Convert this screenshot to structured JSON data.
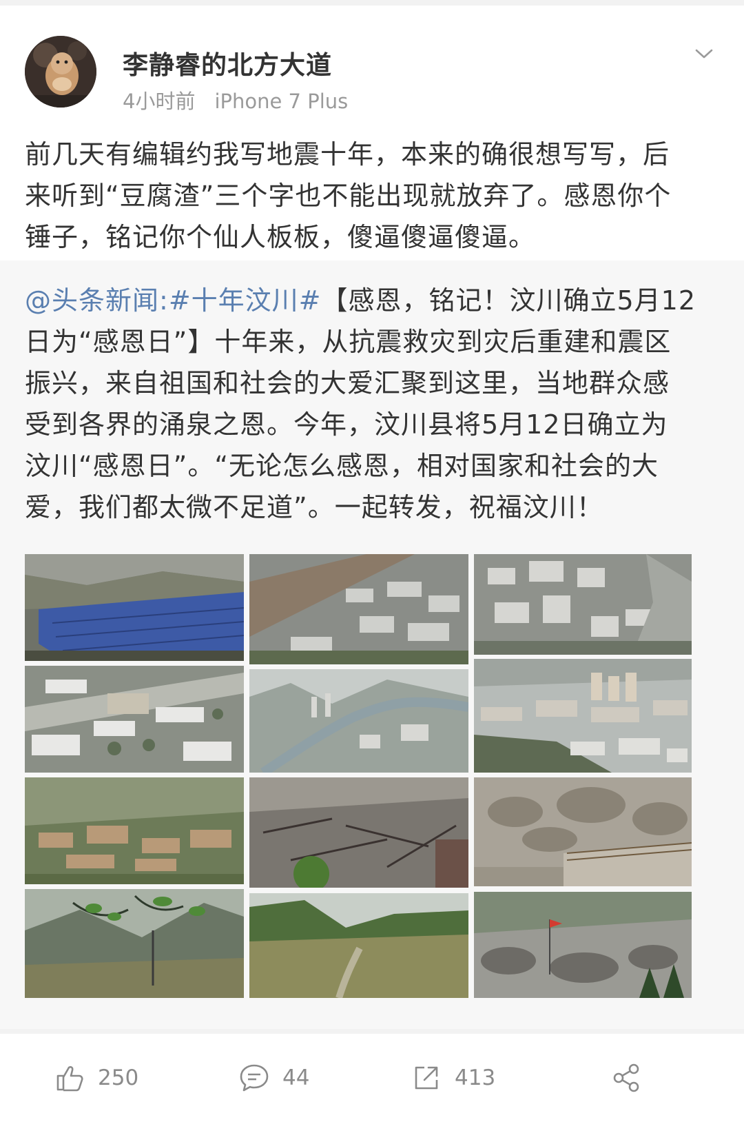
{
  "post": {
    "author": "李静睿的北方大道",
    "time": "4小时前",
    "source": "iPhone 7 Plus",
    "text_lines": [
      "前几天有编辑约我写地震十年，本来的确很想写写，后",
      "来听到“豆腐渣”三个字也不能出现就放弃了。感恩你个",
      "锤子，铭记你个仙人板板，傻逼傻逼傻逼。"
    ]
  },
  "repost": {
    "mention": "@头条新闻:",
    "hashtag": "#十年汶川#",
    "first_line_rest": "【感恩，铭记！汶川确立5月12",
    "lines": [
      "日为“感恩日”】十年来，从抗震救灾到灾后重建和震区",
      "振兴，来自祖国和社会的大爱汇聚到这里，当地群众感",
      "受到各界的涌泉之恩。今年，汶川县将5月12日确立为",
      "汶川“感恩日”。“无论怎么感恩，相对国家和社会的大",
      "爱，我们都太微不足道”。一起转发，祝福汶川！"
    ]
  },
  "photos": [
    {
      "subject": "blue-tents"
    },
    {
      "subject": "river-town-aerial"
    },
    {
      "subject": "town-aerial"
    },
    {
      "subject": "rebuilt-village"
    },
    {
      "subject": "valley-city-haze"
    },
    {
      "subject": "hillside-city"
    },
    {
      "subject": "damaged-village"
    },
    {
      "subject": "rubble-ruins"
    },
    {
      "subject": "landslide-rocks"
    },
    {
      "subject": "mountain-pylon"
    },
    {
      "subject": "green-valley-path"
    },
    {
      "subject": "rubble-flag"
    }
  ],
  "actions": {
    "likes": "250",
    "comments": "44",
    "reposts": "413"
  },
  "colors": {
    "link": "#5a7fb0",
    "meta": "#9a9a9a",
    "text": "#333333"
  }
}
